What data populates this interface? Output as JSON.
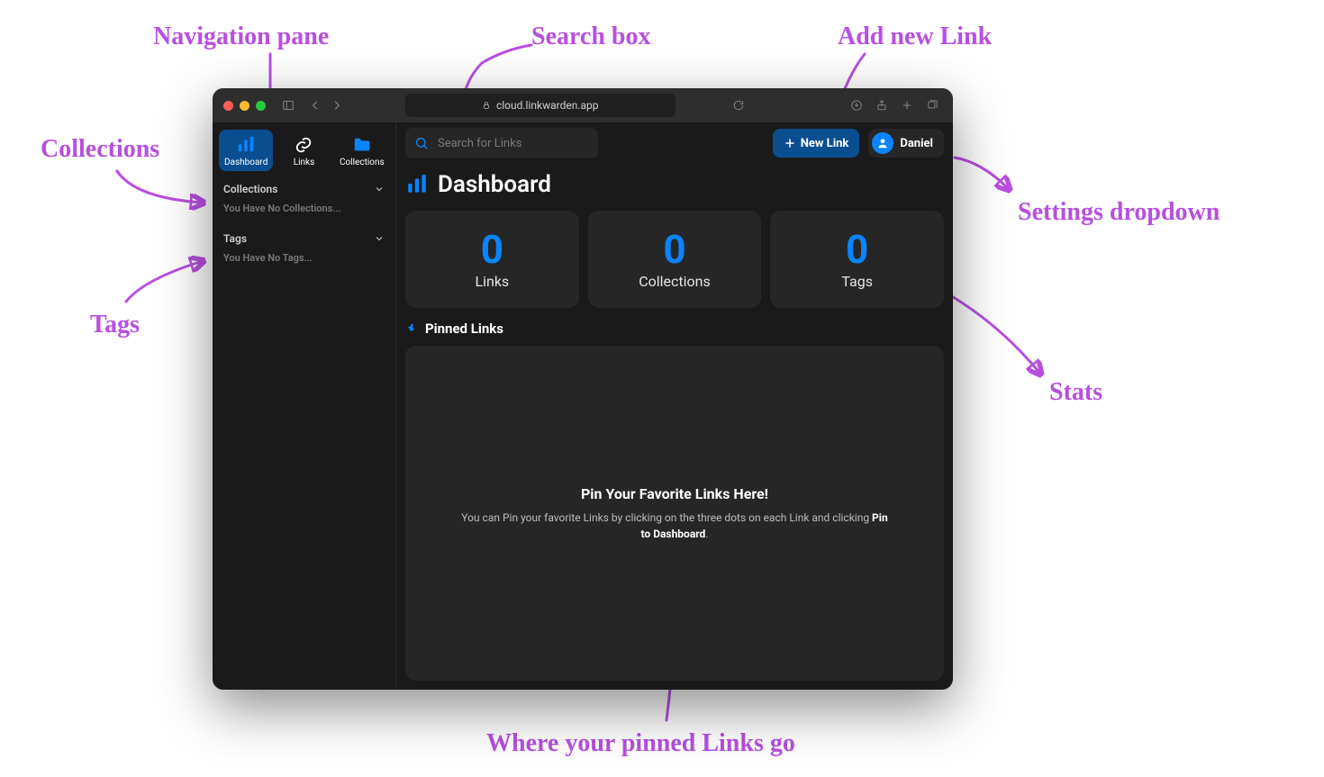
{
  "browser": {
    "url_display": "cloud.linkwarden.app"
  },
  "sidebar": {
    "tabs": [
      {
        "label": "Dashboard"
      },
      {
        "label": "Links"
      },
      {
        "label": "Collections"
      }
    ],
    "collections": {
      "header": "Collections",
      "empty": "You Have No Collections..."
    },
    "tags": {
      "header": "Tags",
      "empty": "You Have No Tags..."
    }
  },
  "topbar": {
    "search_placeholder": "Search for Links",
    "new_link_label": "New Link",
    "user_name": "Daniel"
  },
  "page": {
    "title": "Dashboard"
  },
  "stats": [
    {
      "value": "0",
      "label": "Links"
    },
    {
      "value": "0",
      "label": "Collections"
    },
    {
      "value": "0",
      "label": "Tags"
    }
  ],
  "pinned": {
    "section_title": "Pinned Links",
    "heading": "Pin Your Favorite Links Here!",
    "body_pre": "You can Pin your favorite Links by clicking on the three dots on each Link and clicking ",
    "body_bold": "Pin to Dashboard",
    "body_post": "."
  },
  "annotations": {
    "nav": "Navigation pane",
    "search": "Search box",
    "newlink": "Add new Link",
    "collections": "Collections",
    "settings": "Settings dropdown",
    "tags": "Tags",
    "stats": "Stats",
    "pinned": "Where your pinned Links go"
  }
}
